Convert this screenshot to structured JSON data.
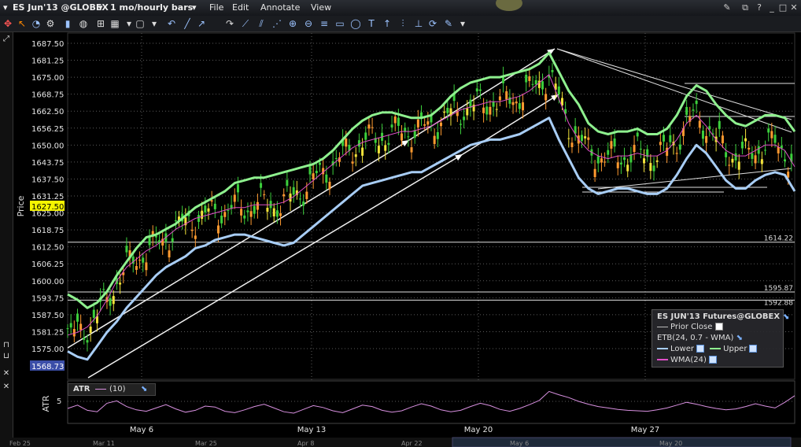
{
  "window": {
    "symbol": "ES Jun'13 @GLOBEX",
    "period": "1 mo/hourly bars",
    "menus": [
      "File",
      "Edit",
      "Annotate",
      "View"
    ]
  },
  "colors": {
    "background": "#000000",
    "upper_band": "#8ef08e",
    "lower_band": "#a8cdf5",
    "wma": "#e050c8",
    "atr": "#d890e0",
    "candle_up": "#3ccf3c",
    "candle_down": "#ff9a30",
    "candle_alt": "#f2e23a",
    "grid": "#5a5a5a",
    "last_price_bg": "#f5f500",
    "low_price_bg": "#3b4ea8"
  },
  "axes": {
    "price_label": "Price",
    "atr_label": "ATR",
    "y_ticks": [
      "1687.50",
      "1681.25",
      "1675.00",
      "1668.75",
      "1662.50",
      "1656.25",
      "1650.00",
      "1643.75",
      "1637.50",
      "1631.25",
      "1625.00",
      "1618.75",
      "1612.50",
      "1606.25",
      "1600.00",
      "1593.75",
      "1587.50",
      "1581.25",
      "1575.00"
    ],
    "last_price": "1627.50",
    "low_price": "1568.73",
    "x_ticks": [
      "May 6",
      "May 13",
      "May 20",
      "May 27"
    ],
    "overview_ticks": [
      "Feb 25",
      "Mar 11",
      "Mar 25",
      "Apr 8",
      "Apr 22",
      "May 6",
      "May 20"
    ],
    "atr_tick": "5"
  },
  "levels": [
    {
      "value": "1614.22"
    },
    {
      "value": "1595.87"
    },
    {
      "value": "1592.88"
    }
  ],
  "legend": {
    "title": "ES JUN'13 Futures@GLOBEX",
    "prior_close": "Prior Close",
    "etb": "ETB(24, 0.7 - WMA)",
    "lower": "Lower",
    "upper": "Upper",
    "wma": "WMA(24)"
  },
  "atr_panel": {
    "label": "ATR",
    "params": "(10)"
  },
  "chart_data": {
    "type": "line",
    "ylim": [
      1568.73,
      1690.0
    ],
    "series": [
      {
        "name": "Upper",
        "values": [
          1595,
          1593,
          1590,
          1592,
          1596,
          1602,
          1607,
          1612,
          1616,
          1617,
          1619,
          1621,
          1624,
          1627,
          1629,
          1631,
          1633,
          1636,
          1637,
          1638,
          1638,
          1639,
          1640,
          1641,
          1642,
          1643,
          1645,
          1648,
          1652,
          1656,
          1659,
          1661,
          1662,
          1662,
          1661,
          1660,
          1660,
          1661,
          1664,
          1668,
          1671,
          1673,
          1674,
          1675,
          1675,
          1676,
          1677,
          1678,
          1680,
          1684,
          1677,
          1670,
          1665,
          1658,
          1655,
          1654,
          1655,
          1655,
          1656,
          1654,
          1654,
          1656,
          1661,
          1668,
          1672,
          1670,
          1665,
          1661,
          1658,
          1657,
          1659,
          1661,
          1661,
          1660,
          1655
        ]
      },
      {
        "name": "Lower",
        "values": [
          1574,
          1572,
          1571,
          1576,
          1581,
          1585,
          1590,
          1594,
          1598,
          1602,
          1605,
          1607,
          1609,
          1612,
          1613,
          1615,
          1616,
          1617,
          1617,
          1616,
          1615,
          1614,
          1613,
          1614,
          1617,
          1620,
          1623,
          1626,
          1629,
          1632,
          1635,
          1636,
          1637,
          1638,
          1639,
          1640,
          1640,
          1642,
          1644,
          1646,
          1648,
          1650,
          1651,
          1652,
          1652,
          1653,
          1654,
          1656,
          1658,
          1660,
          1652,
          1645,
          1638,
          1634,
          1632,
          1633,
          1634,
          1634,
          1633,
          1632,
          1632,
          1634,
          1639,
          1645,
          1650,
          1647,
          1642,
          1637,
          1634,
          1634,
          1637,
          1639,
          1640,
          1639,
          1633
        ]
      },
      {
        "name": "WMA(24)",
        "values": [
          1580,
          1581,
          1583,
          1587,
          1593,
          1600,
          1605,
          1608,
          1611,
          1613,
          1616,
          1619,
          1621,
          1623,
          1624,
          1625,
          1626,
          1627,
          1627,
          1628,
          1628,
          1628,
          1629,
          1631,
          1634,
          1637,
          1640,
          1643,
          1646,
          1649,
          1651,
          1652,
          1653,
          1654,
          1655,
          1655,
          1656,
          1657,
          1659,
          1661,
          1663,
          1664,
          1665,
          1666,
          1666,
          1667,
          1668,
          1670,
          1673,
          1676,
          1667,
          1658,
          1652,
          1648,
          1646,
          1645,
          1646,
          1646,
          1647,
          1646,
          1646,
          1648,
          1652,
          1658,
          1661,
          1657,
          1652,
          1648,
          1646,
          1646,
          1648,
          1650,
          1650,
          1648,
          1642
        ]
      },
      {
        "name": "ATR(10)",
        "values": [
          4.5,
          5.2,
          4.1,
          3.8,
          5.6,
          6.1,
          4.9,
          4.2,
          3.9,
          4.6,
          5.3,
          4.4,
          3.7,
          4.1,
          5.0,
          4.8,
          3.9,
          3.6,
          4.2,
          4.9,
          5.4,
          4.6,
          3.8,
          3.5,
          4.3,
          5.1,
          4.7,
          4.0,
          3.6,
          4.4,
          5.2,
          4.9,
          4.1,
          3.7,
          4.0,
          4.8,
          5.5,
          5.0,
          4.2,
          3.8,
          4.1,
          4.9,
          5.6,
          5.1,
          4.3,
          3.9,
          4.5,
          5.3,
          6.2,
          8.1,
          7.4,
          6.8,
          6.0,
          5.4,
          4.9,
          4.6,
          4.3,
          4.1,
          4.0,
          3.9,
          4.2,
          4.6,
          5.2,
          5.8,
          5.4,
          4.9,
          4.5,
          4.2,
          4.4,
          4.9,
          5.5,
          5.0,
          4.6,
          5.8,
          7.2
        ]
      }
    ]
  }
}
